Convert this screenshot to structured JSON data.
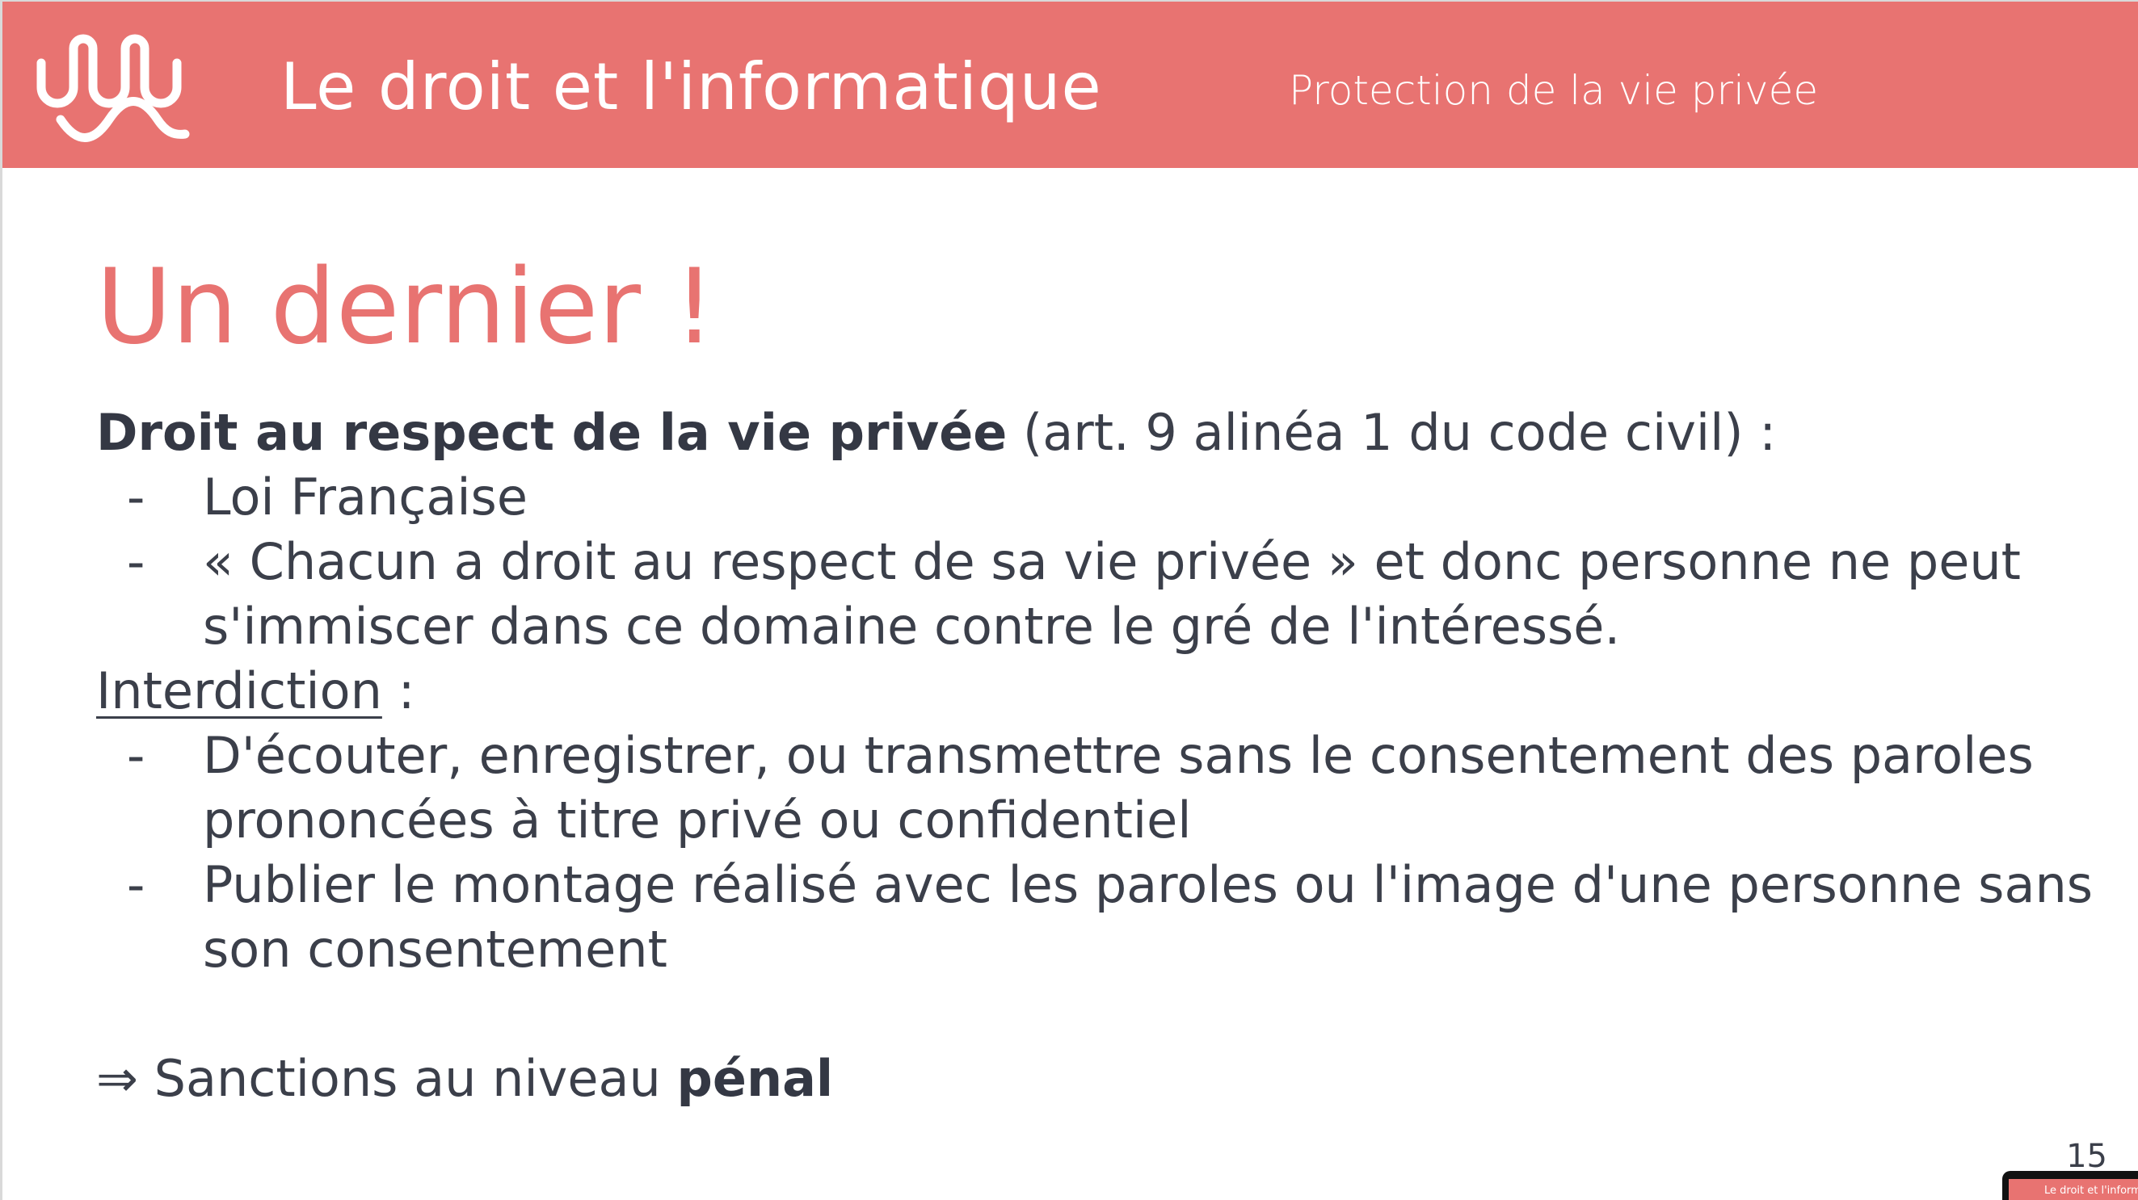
{
  "header": {
    "title": "Le droit et l'informatique",
    "subtitle": "Protection de la vie privée",
    "logo_icon": "wavy-logo-icon"
  },
  "slide": {
    "title": "Un dernier !",
    "intro_bold": "Droit au respect de la vie privée",
    "intro_rest": " (art. 9 alinéa 1 du code civil) :",
    "bullets_1": [
      "Loi Française",
      "« Chacun a droit au respect de sa vie privée » et donc personne ne peut",
      "s'immiscer dans ce domaine contre le gré de l'intéressé."
    ],
    "interdiction_label": "Interdiction",
    "interdiction_suffix": " :",
    "bullets_2": [
      "D'écouter, enregistrer, ou transmettre sans le consentement des paroles",
      "prononcées à titre privé ou confidentiel",
      "Publier le montage réalisé avec les paroles ou l'image d'une personne sans",
      "son consentement"
    ],
    "dash": "-",
    "sanction_arrow": "⇒",
    "sanction_text": " Sanctions au niveau ",
    "sanction_bold": "pénal",
    "page_number": "15"
  },
  "thumbnail": {
    "label": "Le droit et l'informatique"
  },
  "colors": {
    "accent": "#e87371",
    "text": "#3b3f4a",
    "header_text": "#ffffff"
  }
}
